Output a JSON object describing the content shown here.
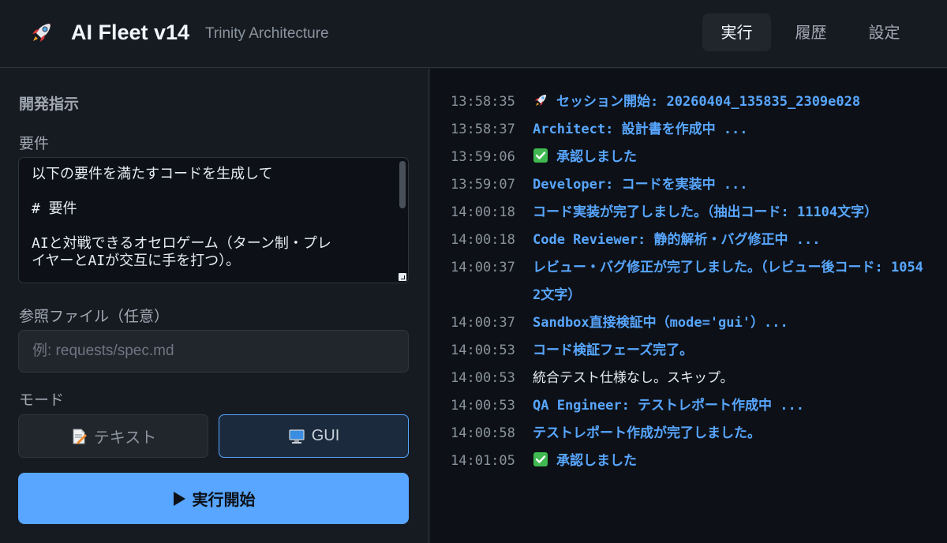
{
  "header": {
    "logo_icon": "rocket-icon",
    "title": "AI Fleet v14",
    "subtitle": "Trinity Architecture",
    "nav": [
      {
        "label": "実行",
        "active": true
      },
      {
        "label": "履歴",
        "active": false
      },
      {
        "label": "設定",
        "active": false
      }
    ]
  },
  "left": {
    "section_title": "開発指示",
    "requirements": {
      "label": "要件",
      "lines": [
        "以下の要件を満たすコードを生成して",
        "# 要件",
        "AIと対戦できるオセロゲーム（ターン制・プレ",
        "イヤーとAIが交互に手を打つ）。"
      ]
    },
    "reference": {
      "label": "参照ファイル（任意）",
      "value": "",
      "placeholder": "例: requests/spec.md"
    },
    "mode": {
      "label": "モード",
      "options": [
        {
          "label": "テキスト",
          "icon": "memo-icon",
          "selected": false
        },
        {
          "label": "GUI",
          "icon": "monitor-icon",
          "selected": true
        }
      ]
    },
    "run_button": {
      "label": "実行開始",
      "icon": "play-icon"
    }
  },
  "log": [
    {
      "time": "13:58:35",
      "icon": "rocket-icon",
      "text": "セッション開始: 20260404_135835_2309e028",
      "style": "highlight"
    },
    {
      "time": "13:58:37",
      "icon": "",
      "text": "Architect: 設計書を作成中 ...",
      "style": "highlight"
    },
    {
      "time": "13:59:06",
      "icon": "check-icon",
      "text": "承認しました",
      "style": "highlight"
    },
    {
      "time": "13:59:07",
      "icon": "",
      "text": "Developer: コードを実装中 ...",
      "style": "highlight"
    },
    {
      "time": "14:00:18",
      "icon": "",
      "text": "コード実装が完了しました。（抽出コード: 11104文字）",
      "style": "highlight"
    },
    {
      "time": "14:00:18",
      "icon": "",
      "text": "Code Reviewer: 静的解析・バグ修正中 ...",
      "style": "highlight"
    },
    {
      "time": "14:00:37",
      "icon": "",
      "text": "レビュー・バグ修正が完了しました。（レビュー後コード: 10542文字）",
      "style": "highlight"
    },
    {
      "time": "14:00:37",
      "icon": "",
      "text": "Sandbox直接検証中（mode='gui'）...",
      "style": "highlight"
    },
    {
      "time": "14:00:53",
      "icon": "",
      "text": "コード検証フェーズ完了。",
      "style": "highlight"
    },
    {
      "time": "14:00:53",
      "icon": "",
      "text": "統合テスト仕様なし。スキップ。",
      "style": "plain"
    },
    {
      "time": "14:00:53",
      "icon": "",
      "text": "QA Engineer: テストレポート作成中 ...",
      "style": "highlight"
    },
    {
      "time": "14:00:58",
      "icon": "",
      "text": "テストレポート作成が完了しました。",
      "style": "highlight"
    },
    {
      "time": "14:01:05",
      "icon": "check-icon",
      "text": "承認しました",
      "style": "highlight"
    }
  ],
  "colors": {
    "accent": "#58a6ff",
    "background": "#161b22",
    "panel": "#0d1117",
    "success": "#3fb950"
  }
}
